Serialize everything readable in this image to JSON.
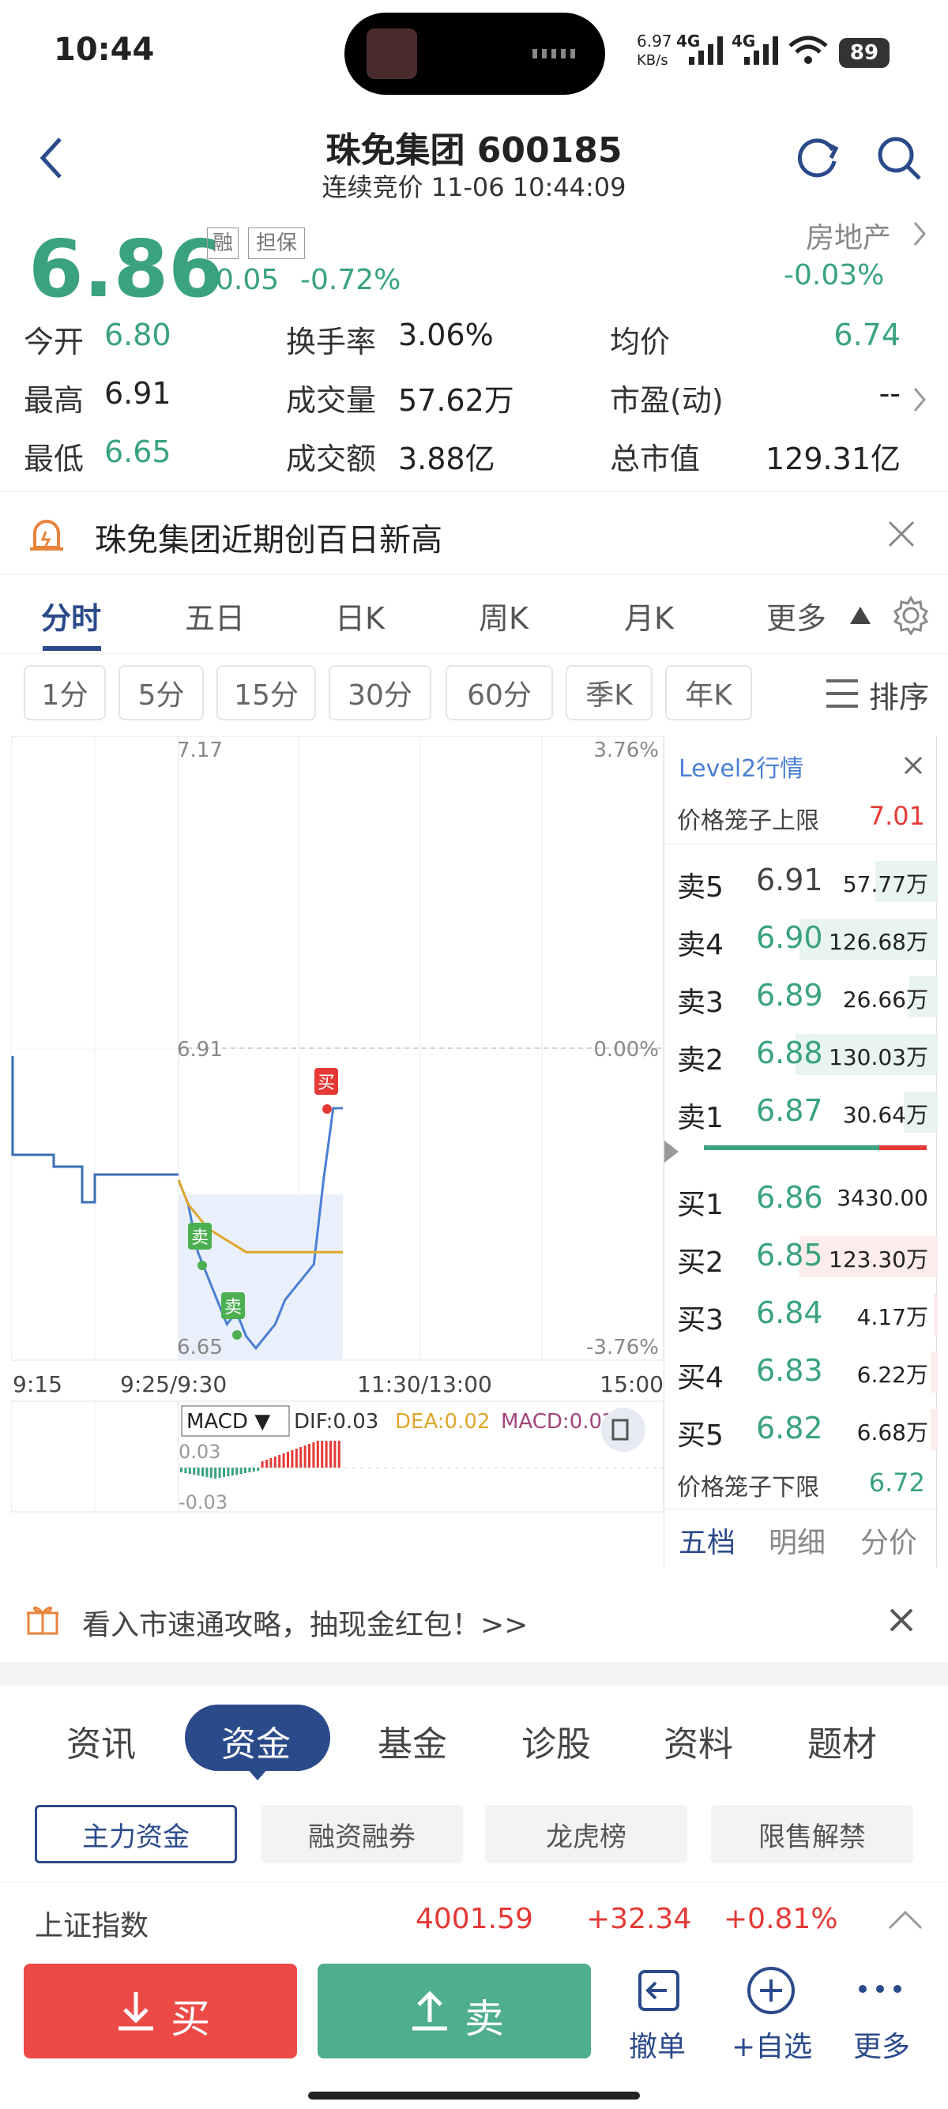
{
  "status_bar": {
    "time": "10:44",
    "net_speed": "6.97",
    "net_unit": "KB/s",
    "signal1": "4G",
    "signal2": "4G",
    "battery": "89"
  },
  "header": {
    "title": "珠免集团 600185",
    "subtitle": "连续竞价 11-06 10:44:09",
    "back_icon": "chevron-left-icon",
    "refresh_icon": "refresh-icon",
    "search_icon": "search-icon"
  },
  "quote": {
    "price": "6.86",
    "change": "-0.05",
    "change_pct": "-0.72%",
    "badge_rong": "融",
    "badge_danbao": "担保",
    "sector": "房地产",
    "sector_change": "-0.03%",
    "fields": [
      {
        "label": "今开",
        "value": "6.80"
      },
      {
        "label": "换手率",
        "value": "3.06%"
      },
      {
        "label": "均价",
        "value": "6.74"
      },
      {
        "label": "最高",
        "value": "6.91"
      },
      {
        "label": "成交量",
        "value": "57.62万"
      },
      {
        "label": "市盈(动)",
        "value": "--"
      },
      {
        "label": "最低",
        "value": "6.65"
      },
      {
        "label": "成交额",
        "value": "3.88亿"
      },
      {
        "label": "总市值",
        "value": "129.31亿"
      }
    ]
  },
  "banner": {
    "text": "珠免集团近期创百日新高"
  },
  "period_tabs": [
    "分时",
    "五日",
    "日K",
    "周K",
    "月K",
    "更多"
  ],
  "interval_tabs": [
    "1分",
    "5分",
    "15分",
    "30分",
    "60分",
    "季K",
    "年K"
  ],
  "sort_label": "排序",
  "chart": {
    "top_price": "7.17",
    "top_pct": "3.76%",
    "mid_price": "6.91",
    "mid_pct": "0.00%",
    "bottom_price": "6.65",
    "bottom_pct": "-3.76%",
    "time_labels": [
      "9:15",
      "9:25/9:30",
      "11:30/13:00",
      "15:00"
    ],
    "buy_marker": "买",
    "sell_marker": "卖",
    "macd_select": "MACD ▼",
    "dif": "DIF:0.03",
    "dea": "DEA:0.02",
    "macd": "MACD:0.02",
    "macd_top": "0.03",
    "macd_bottom": "-0.03"
  },
  "chart_data": {
    "type": "line",
    "title": "",
    "ylim": [
      6.65,
      7.17
    ],
    "prev_close": 6.91,
    "series": [
      {
        "name": "price",
        "color": "#4a7fd4",
        "values": [
          6.8,
          6.78,
          6.74,
          6.72,
          6.7,
          6.68,
          6.69,
          6.67,
          6.66,
          6.67,
          6.68,
          6.7,
          6.71,
          6.72,
          6.73,
          6.8,
          6.86,
          6.86
        ]
      },
      {
        "name": "avg",
        "color": "#e0a62c",
        "values": [
          6.8,
          6.78,
          6.77,
          6.76,
          6.755,
          6.75,
          6.745,
          6.74,
          6.74,
          6.74,
          6.74,
          6.74,
          6.74,
          6.74,
          6.74,
          6.74,
          6.74,
          6.74
        ]
      }
    ]
  },
  "orderbook": {
    "title": "Level2行情",
    "upper_limit_label": "价格笼子上限",
    "upper_limit": "7.01",
    "asks": [
      {
        "label": "卖5",
        "price": "6.91",
        "vol": "57.77万",
        "fill": 0.44
      },
      {
        "label": "卖4",
        "price": "6.90",
        "vol": "126.68万",
        "fill": 0.97
      },
      {
        "label": "卖3",
        "price": "6.89",
        "vol": "26.66万",
        "fill": 0.2
      },
      {
        "label": "卖2",
        "price": "6.88",
        "vol": "130.03万",
        "fill": 1.0
      },
      {
        "label": "卖1",
        "price": "6.87",
        "vol": "30.64万",
        "fill": 0.24
      }
    ],
    "bids": [
      {
        "label": "买1",
        "price": "6.86",
        "vol": "3430.00",
        "fill": 0.0
      },
      {
        "label": "买2",
        "price": "6.85",
        "vol": "123.30万",
        "fill": 0.97
      },
      {
        "label": "买3",
        "price": "6.84",
        "vol": "4.17万",
        "fill": 0.03
      },
      {
        "label": "买4",
        "price": "6.83",
        "vol": "6.22万",
        "fill": 0.05
      },
      {
        "label": "买5",
        "price": "6.82",
        "vol": "6.68万",
        "fill": 0.05
      }
    ],
    "lower_limit_label": "价格笼子下限",
    "lower_limit": "6.72",
    "tabs": [
      "五档",
      "明细",
      "分价"
    ]
  },
  "promo": {
    "text": "看入市速通攻略，抽现金红包！>>"
  },
  "feature_tabs": [
    "资讯",
    "资金",
    "基金",
    "诊股",
    "资料",
    "题材"
  ],
  "fund_buttons": [
    "主力资金",
    "融资融券",
    "龙虎榜",
    "限售解禁"
  ],
  "index_row": {
    "name": "上证指数",
    "value": "4001.59",
    "change": "+32.34",
    "pct": "+0.81%"
  },
  "bottom_bar": {
    "buy": "买",
    "sell": "卖",
    "cancel": "撤单",
    "watch": "+自选",
    "more": "更多"
  }
}
